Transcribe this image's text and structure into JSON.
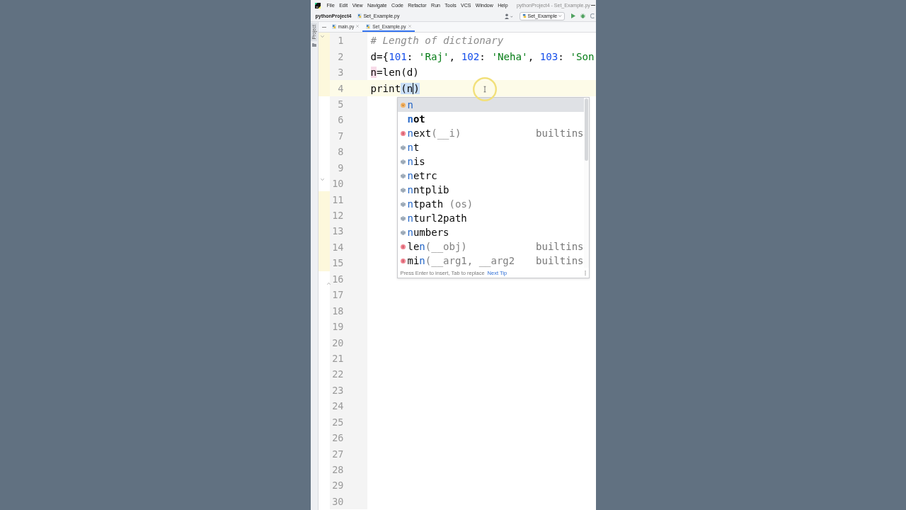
{
  "menu_bar": {
    "items": [
      "File",
      "Edit",
      "View",
      "Navigate",
      "Code",
      "Refactor",
      "Run",
      "Tools",
      "VCS",
      "Window",
      "Help"
    ],
    "title": "pythonProject4 - Set_Example.py"
  },
  "nav_bar": {
    "project": "pythonProject4",
    "file": "Set_Example.py",
    "run_config": "Set_Example"
  },
  "side_panel": {
    "label": "Project"
  },
  "tabs": [
    {
      "label": "main.py",
      "selected": false
    },
    {
      "label": "Set_Example.py",
      "selected": true
    }
  ],
  "editor": {
    "lines": [
      {
        "number": "1",
        "current": false,
        "changed": true,
        "fold_start": true,
        "fold_end": false,
        "code": [
          {
            "text": "# Length of dictionary",
            "kind": "comment",
            "caret_after": false
          }
        ]
      },
      {
        "number": "2",
        "current": false,
        "changed": true,
        "fold_start": false,
        "fold_end": false,
        "code": [
          {
            "text": "d={",
            "kind": "plain",
            "caret_after": false
          },
          {
            "text": "101",
            "kind": "number",
            "caret_after": false
          },
          {
            "text": ": ",
            "kind": "plain",
            "caret_after": false
          },
          {
            "text": "'Raj'",
            "kind": "string",
            "caret_after": false
          },
          {
            "text": ", ",
            "kind": "plain",
            "caret_after": false
          },
          {
            "text": "102",
            "kind": "number",
            "caret_after": false
          },
          {
            "text": ": ",
            "kind": "plain",
            "caret_after": false
          },
          {
            "text": "'Neha'",
            "kind": "string",
            "caret_after": false
          },
          {
            "text": ", ",
            "kind": "plain",
            "caret_after": false
          },
          {
            "text": "103",
            "kind": "number",
            "caret_after": false
          },
          {
            "text": ": ",
            "kind": "plain",
            "caret_after": false
          },
          {
            "text": "'Son",
            "kind": "string",
            "caret_after": false
          }
        ]
      },
      {
        "number": "3",
        "current": false,
        "changed": true,
        "fold_start": false,
        "fold_end": false,
        "code": [
          {
            "text": "n",
            "kind": "usage",
            "caret_after": false
          },
          {
            "text": "=len(d)",
            "kind": "plain",
            "caret_after": false
          }
        ]
      },
      {
        "number": "4",
        "current": true,
        "changed": true,
        "fold_start": false,
        "fold_end": false,
        "code": [
          {
            "text": "print",
            "kind": "plain",
            "caret_after": false
          },
          {
            "text": "(",
            "kind": "match",
            "caret_after": false
          },
          {
            "text": "n",
            "kind": "match",
            "caret_after": true
          },
          {
            "text": ")",
            "kind": "match",
            "caret_after": false
          }
        ]
      },
      {
        "number": "5",
        "current": false,
        "changed": false,
        "fold_start": false,
        "fold_end": false
      },
      {
        "number": "6",
        "current": false,
        "changed": false,
        "fold_start": false,
        "fold_end": false
      },
      {
        "number": "7",
        "current": false,
        "changed": false,
        "fold_start": false,
        "fold_end": false
      },
      {
        "number": "8",
        "current": false,
        "changed": false,
        "fold_start": false,
        "fold_end": false
      },
      {
        "number": "9",
        "current": false,
        "changed": false,
        "fold_start": false,
        "fold_end": false
      },
      {
        "number": "10",
        "current": false,
        "changed": false,
        "fold_start": true,
        "fold_end": false
      },
      {
        "number": "11",
        "current": false,
        "changed": true,
        "fold_start": false,
        "fold_end": false
      },
      {
        "number": "12",
        "current": false,
        "changed": true,
        "fold_start": false,
        "fold_end": false
      },
      {
        "number": "13",
        "current": false,
        "changed": true,
        "fold_start": false,
        "fold_end": false
      },
      {
        "number": "14",
        "current": false,
        "changed": true,
        "fold_start": false,
        "fold_end": false
      },
      {
        "number": "15",
        "current": false,
        "changed": true,
        "fold_start": false,
        "fold_end": false
      },
      {
        "number": "16",
        "current": false,
        "changed": false,
        "fold_start": false,
        "fold_end": true
      },
      {
        "number": "17",
        "current": false,
        "changed": false,
        "fold_start": false,
        "fold_end": false
      },
      {
        "number": "18",
        "current": false,
        "changed": false,
        "fold_start": false,
        "fold_end": false
      },
      {
        "number": "19",
        "current": false,
        "changed": false,
        "fold_start": false,
        "fold_end": false
      },
      {
        "number": "20",
        "current": false,
        "changed": false,
        "fold_start": false,
        "fold_end": false
      },
      {
        "number": "21",
        "current": false,
        "changed": false,
        "fold_start": false,
        "fold_end": false
      },
      {
        "number": "22",
        "current": false,
        "changed": false,
        "fold_start": false,
        "fold_end": false
      },
      {
        "number": "23",
        "current": false,
        "changed": false,
        "fold_start": false,
        "fold_end": false
      },
      {
        "number": "24",
        "current": false,
        "changed": false,
        "fold_start": false,
        "fold_end": false
      },
      {
        "number": "25",
        "current": false,
        "changed": false,
        "fold_start": false,
        "fold_end": false
      },
      {
        "number": "26",
        "current": false,
        "changed": false,
        "fold_start": false,
        "fold_end": false
      },
      {
        "number": "27",
        "current": false,
        "changed": false,
        "fold_start": false,
        "fold_end": false
      },
      {
        "number": "28",
        "current": false,
        "changed": false,
        "fold_start": false,
        "fold_end": false
      },
      {
        "number": "29",
        "current": false,
        "changed": false,
        "fold_start": false,
        "fold_end": false
      },
      {
        "number": "30",
        "current": false,
        "changed": false,
        "fold_start": false,
        "fold_end": false
      }
    ]
  },
  "completion_popup": {
    "items": [
      {
        "kind": "variable",
        "selected": true,
        "parts": [
          {
            "text": "n",
            "kind": "match"
          }
        ]
      },
      {
        "kind": "keyword",
        "selected": false,
        "parts": [
          {
            "text": "n",
            "kind": "match"
          },
          {
            "text": "ot",
            "kind": "plain"
          }
        ]
      },
      {
        "kind": "function",
        "selected": false,
        "parts": [
          {
            "text": "n",
            "kind": "match"
          },
          {
            "text": "ext",
            "kind": "plain"
          },
          {
            "text": "(__i)",
            "kind": "param"
          }
        ],
        "location": "builtins"
      },
      {
        "kind": "module",
        "selected": false,
        "parts": [
          {
            "text": "n",
            "kind": "match"
          },
          {
            "text": "t",
            "kind": "plain"
          }
        ]
      },
      {
        "kind": "module",
        "selected": false,
        "parts": [
          {
            "text": "n",
            "kind": "match"
          },
          {
            "text": "is",
            "kind": "plain"
          }
        ]
      },
      {
        "kind": "module",
        "selected": false,
        "parts": [
          {
            "text": "n",
            "kind": "match"
          },
          {
            "text": "etrc",
            "kind": "plain"
          }
        ]
      },
      {
        "kind": "module",
        "selected": false,
        "parts": [
          {
            "text": "n",
            "kind": "match"
          },
          {
            "text": "ntplib",
            "kind": "plain"
          }
        ]
      },
      {
        "kind": "module",
        "selected": false,
        "parts": [
          {
            "text": "n",
            "kind": "match"
          },
          {
            "text": "tpath",
            "kind": "plain"
          },
          {
            "text": " (os)",
            "kind": "param"
          }
        ]
      },
      {
        "kind": "module",
        "selected": false,
        "parts": [
          {
            "text": "n",
            "kind": "match"
          },
          {
            "text": "turl2path",
            "kind": "plain"
          }
        ]
      },
      {
        "kind": "module",
        "selected": false,
        "parts": [
          {
            "text": "n",
            "kind": "match"
          },
          {
            "text": "umbers",
            "kind": "plain"
          }
        ]
      },
      {
        "kind": "function",
        "selected": false,
        "parts": [
          {
            "text": "le",
            "kind": "plain"
          },
          {
            "text": "n",
            "kind": "match"
          },
          {
            "text": "(__obj)",
            "kind": "param"
          }
        ],
        "location": "builtins"
      },
      {
        "kind": "function",
        "selected": false,
        "parts": [
          {
            "text": "mi",
            "kind": "plain"
          },
          {
            "text": "n",
            "kind": "match"
          },
          {
            "text": "(__arg1, __arg2",
            "kind": "param"
          }
        ],
        "location": "builtins"
      }
    ],
    "hint": "Press Enter to insert, Tab to replace",
    "link": "Next Tip"
  }
}
